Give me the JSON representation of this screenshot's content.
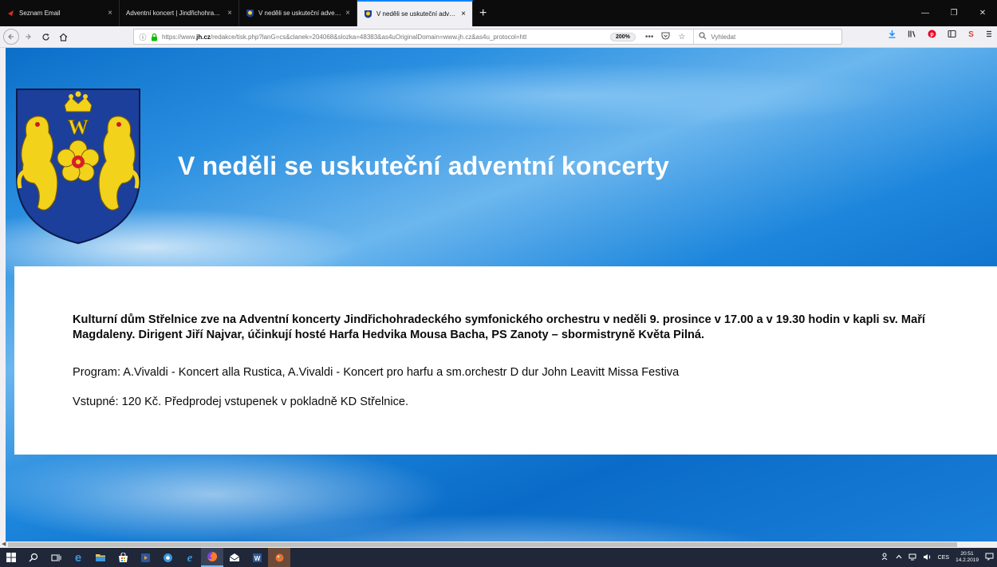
{
  "browser": {
    "tabs": [
      {
        "title": "Seznam Email",
        "favicon_color": "#d0302a",
        "active": false
      },
      {
        "title": "Adventní koncert | Jindřichohradec",
        "favicon_color": "#0c0c0d",
        "active": false
      },
      {
        "title": "V neděli se uskuteční adventní",
        "favicon_color": "#d8b31f",
        "active": false
      },
      {
        "title": "V neděli se uskuteční adventní",
        "favicon_color": "#d8b31f",
        "active": true
      }
    ],
    "tab_close_glyph": "×",
    "new_tab_glyph": "+",
    "window_controls": {
      "minimize": "—",
      "maximize": "❐",
      "close": "✕"
    },
    "url": {
      "prefix": "https://www.",
      "domain": "jh.cz",
      "path": "/redakce/tisk.php?lanG=cs&clanek=204068&slozka=48383&as4uOriginalDomain=www.jh.cz&as4u_protocol=htt"
    },
    "zoom_level": "200%",
    "page_actions_glyph": "•••",
    "search_placeholder": "Vyhledat"
  },
  "page": {
    "title": "V neděli se uskuteční adventní koncerty",
    "lead": "Kulturní dům Střelnice zve na Adventní koncerty Jindřichohradeckého symfonického orchestru v neděli 9. prosince v 17.00 a v 19.30 hodin v kapli sv. Maří Magdaleny. Dirigent Jiří Najvar, účinkují hosté Harfa Hedvika Mousa Bacha, PS Zanoty – sbormistryně Květa Pilná.",
    "program": "Program: A.Vivaldi - Koncert alla Rustica, A.Vivaldi - Koncert pro harfu a sm.orchestr D dur John Leavitt Missa Festiva",
    "admission": "Vstupné: 120 Kč. Předprodej vstupenek v pokladně KD Střelnice."
  },
  "taskbar": {
    "apps": [
      {
        "icon": "windows-start-icon",
        "color": "#ffffff"
      },
      {
        "icon": "search-icon",
        "color": "#ffffff"
      },
      {
        "icon": "task-view-icon",
        "color": "#ffffff"
      },
      {
        "icon": "edge-icon",
        "color": "#3a96dd"
      },
      {
        "icon": "file-explorer-icon",
        "color": "#f0c24a"
      },
      {
        "icon": "store-icon",
        "color": "#ffffff"
      },
      {
        "icon": "media-icon",
        "color": "#f0a030"
      },
      {
        "icon": "settings-app-icon",
        "color": "#3a96dd"
      },
      {
        "icon": "internet-explorer-icon",
        "color": "#3a96dd"
      },
      {
        "icon": "firefox-icon",
        "color": "#ff7a29",
        "active": true
      },
      {
        "icon": "mail-icon",
        "color": "#ffffff"
      },
      {
        "icon": "word-icon",
        "color": "#2b5797"
      },
      {
        "icon": "paint-icon",
        "color": "#f07030"
      }
    ],
    "language": "CES",
    "time": "20:51",
    "date": "14.2.2019"
  },
  "colors": {
    "accent": "#0a84ff",
    "page_background": "#1a7fd8",
    "title_text": "#ffffff",
    "coat_of_arms_field": "#1c3f9b",
    "coat_of_arms_gold": "#f3d21c"
  }
}
